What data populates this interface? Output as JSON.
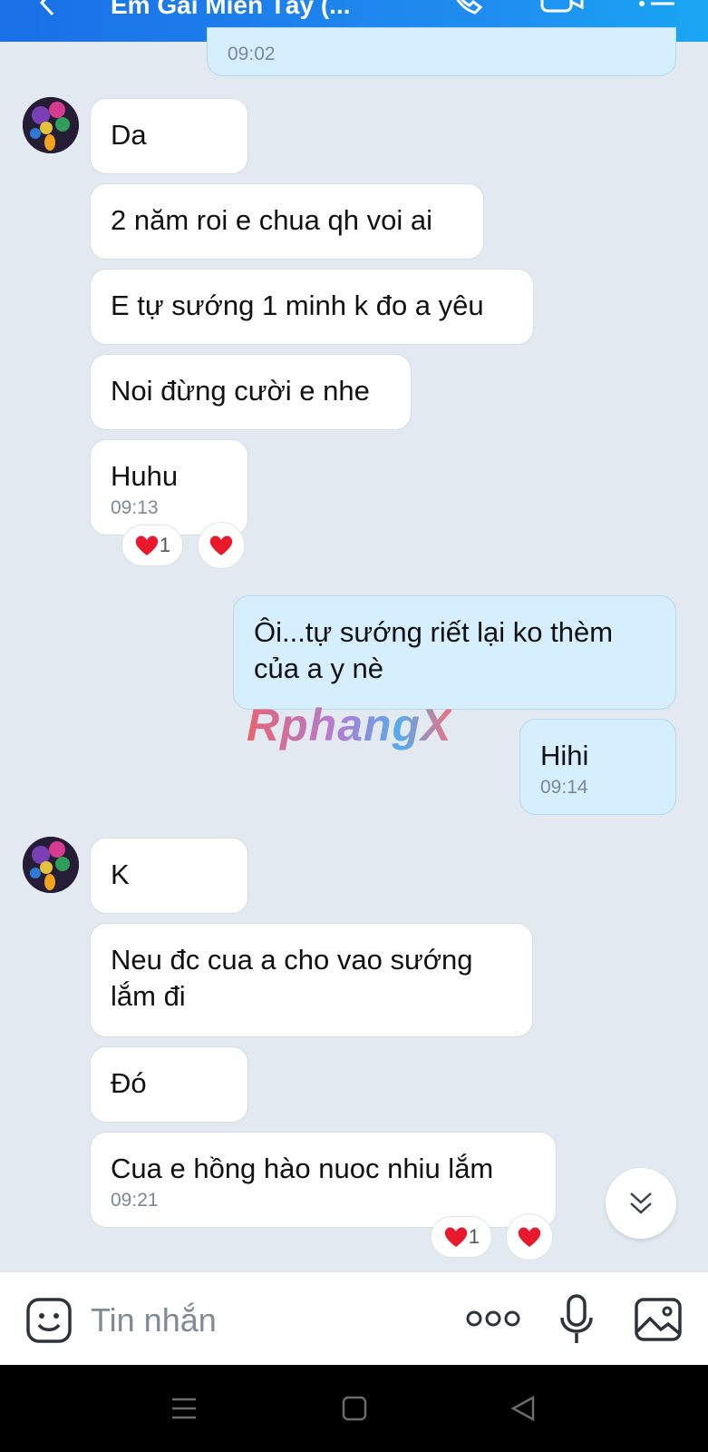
{
  "header": {
    "title": "Em Gái Miền Tây (...",
    "back_icon": "arrow-left-icon",
    "call_icon": "phone-icon",
    "video_icon": "video-camera-icon",
    "menu_icon": "list-menu-icon",
    "background": "#1f8ef0"
  },
  "messages": {
    "m0": {
      "time": "09:02",
      "sender": "me"
    },
    "m1": {
      "text": "Da",
      "sender": "contact"
    },
    "m2": {
      "text": "2 năm roi e chua qh voi ai",
      "sender": "contact"
    },
    "m3": {
      "text": "E tự sướng 1 minh k đo a yêu",
      "sender": "contact"
    },
    "m4": {
      "text": "Noi đừng cười e nhe",
      "sender": "contact"
    },
    "m5": {
      "text": "Huhu",
      "time": "09:13",
      "sender": "contact",
      "reactions": [
        {
          "icon": "heart-icon",
          "count": "1"
        },
        {
          "icon": "heart-icon"
        }
      ]
    },
    "m6": {
      "text": "Ôi...tự sướng riết lại ko thèm của a y nè",
      "sender": "me"
    },
    "m7": {
      "text": "Hihi",
      "time": "09:14",
      "sender": "me"
    },
    "m8": {
      "text": "K",
      "sender": "contact"
    },
    "m9": {
      "text": "Neu đc cua a cho vao sướng lắm đi",
      "sender": "contact"
    },
    "m10": {
      "text": "Đó",
      "sender": "contact"
    },
    "m11": {
      "text": "Cua e hồng hào nuoc nhiu lắm",
      "time": "09:21",
      "sender": "contact",
      "reactions": [
        {
          "icon": "heart-icon",
          "count": "1"
        },
        {
          "icon": "heart-icon"
        }
      ]
    }
  },
  "watermark": "RphangX",
  "composer": {
    "placeholder": "Tin nhắn",
    "emoji_icon": "smiley-sticker-icon",
    "more_icon": "more-dots-icon",
    "mic_icon": "microphone-icon",
    "image_icon": "image-icon"
  },
  "colors": {
    "chat_background": "#e2e9f1",
    "my_bubble": "#d5efff",
    "their_bubble": "#ffffff",
    "heart": "#e8192c"
  }
}
